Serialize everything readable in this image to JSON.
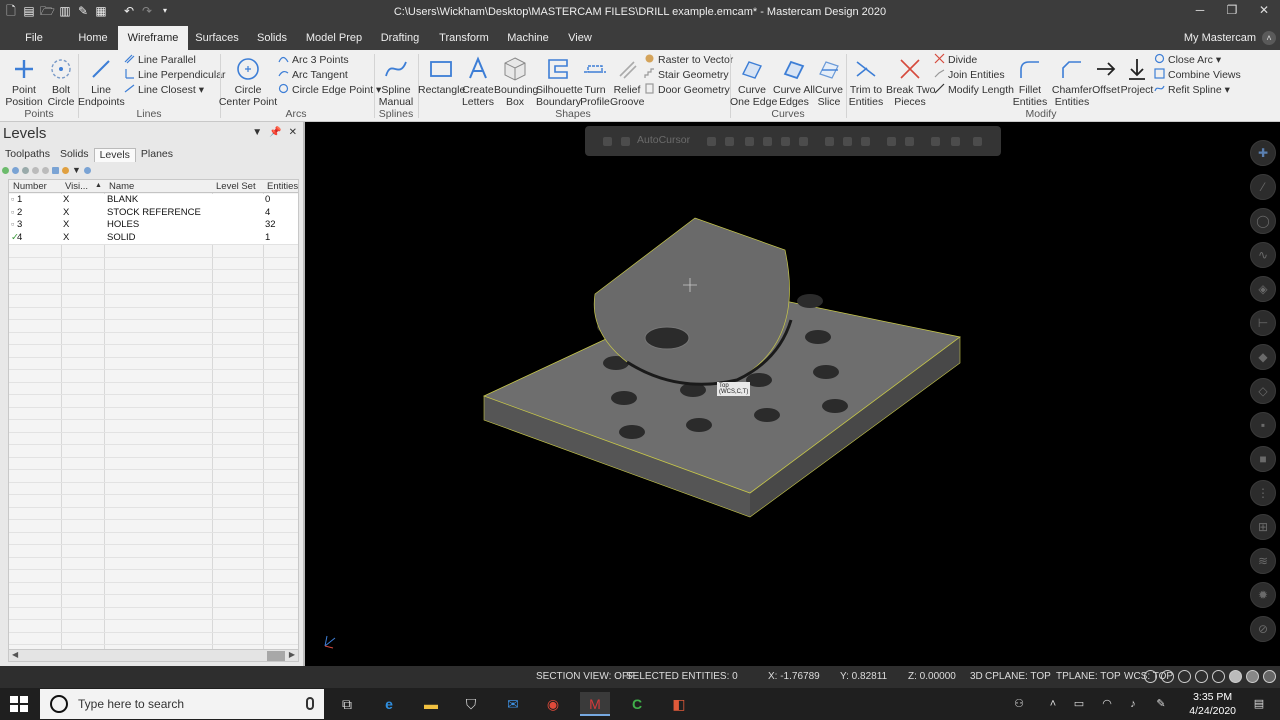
{
  "window": {
    "title": "C:\\Users\\Wickham\\Desktop\\MASTERCAM FILES\\DRILL example.emcam* - Mastercam Design 2020",
    "min": "─",
    "restore": "❐",
    "close": "✕"
  },
  "tabs": [
    "File",
    "Home",
    "Wireframe",
    "Surfaces",
    "Solids",
    "Model Prep",
    "Drafting",
    "Transform",
    "Machine",
    "View"
  ],
  "account": "My Mastercam",
  "ribbon": {
    "point_position": "Point\nPosition",
    "bolt_circle": "Bolt\nCircle",
    "line_endpoints": "Line\nEndpoints",
    "line_parallel": "Line Parallel",
    "line_perpendicular": "Line Perpendicular",
    "line_closest": "Line Closest",
    "circle_center_point": "Circle\nCenter Point",
    "arc_3_points": "Arc 3 Points",
    "arc_tangent": "Arc Tangent",
    "circle_edge_point": "Circle Edge Point",
    "spline_manual": "Spline\nManual",
    "rectangle": "Rectangle",
    "create_letters": "Create\nLetters",
    "bounding_box": "Bounding\nBox",
    "silhouette_boundary": "Silhouette\nBoundary",
    "turn_profile": "Turn\nProfile",
    "relief_groove": "Relief\nGroove",
    "raster_to_vector": "Raster to Vector",
    "stair_geometry": "Stair Geometry",
    "door_geometry": "Door Geometry",
    "curve_one_edge": "Curve\nOne Edge",
    "curve_all_edges": "Curve All\nEdges",
    "curve_slice": "Curve\nSlice",
    "trim_to_entities": "Trim to\nEntities",
    "break_two_pieces": "Break Two\nPieces",
    "divide": "Divide",
    "join_entities": "Join Entities",
    "modify_length": "Modify Length",
    "fillet_entities": "Fillet\nEntities",
    "chamfer_entities": "Chamfer\nEntities",
    "offset": "Offset",
    "project": "Project",
    "close_arc": "Close Arc",
    "combine_views": "Combine Views",
    "refit_spline": "Refit Spline",
    "groups": {
      "points": "Points",
      "lines": "Lines",
      "arcs": "Arcs",
      "splines": "Splines",
      "shapes": "Shapes",
      "curves": "Curves",
      "modify": "Modify"
    }
  },
  "levels_panel": {
    "title": "Levels",
    "tabs": [
      "Toolpaths",
      "Solids",
      "Levels",
      "Planes"
    ],
    "columns": [
      "Number",
      "Visi...",
      "Name",
      "Level Set",
      "Entities"
    ],
    "rows": [
      {
        "number": "1",
        "visible": "X",
        "name": "BLANK",
        "level_set": "",
        "entities": "0"
      },
      {
        "number": "2",
        "visible": "X",
        "name": "STOCK REFERENCE",
        "level_set": "",
        "entities": "4"
      },
      {
        "number": "3",
        "visible": "X",
        "name": "HOLES",
        "level_set": "",
        "entities": "32"
      },
      {
        "number": "4",
        "visible": "X",
        "name": "SOLID",
        "level_set": "",
        "entities": "1"
      }
    ]
  },
  "viewport": {
    "autocursor": "AutoCursor",
    "wcs_label_1": "Top",
    "wcs_label_2": "(WCS,C,T)"
  },
  "status": {
    "section_view": "SECTION VIEW: OFF",
    "selected": "SELECTED ENTITIES: 0",
    "x": "X:  -1.76789",
    "y": "Y:  0.82811",
    "z": "Z:  0.00000",
    "mode": "3D",
    "cplane": "CPLANE: TOP",
    "tplane": "TPLANE: TOP",
    "wcs": "WCS: TOP"
  },
  "taskbar": {
    "search_placeholder": "Type here to search",
    "time": "3:35 PM",
    "date": "4/24/2020"
  },
  "colors": {
    "part": "#6e6e6e",
    "part_side": "#4a4a4a",
    "part_front": "#555555",
    "edge": "#c8c84a",
    "hole": "#2b2b2b"
  }
}
